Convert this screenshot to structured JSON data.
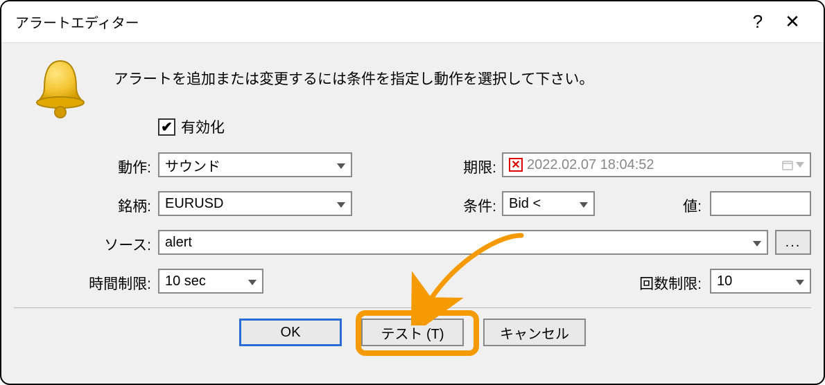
{
  "window": {
    "title": "アラートエディター"
  },
  "instruction": "アラートを追加または変更するには条件を指定し動作を選択して下さい。",
  "enable": {
    "label": "有効化",
    "checked": true
  },
  "labels": {
    "action": "動作:",
    "symbol": "銘柄:",
    "source": "ソース:",
    "timeout": "時間制限:",
    "deadline": "期限:",
    "condition": "条件:",
    "value": "値:",
    "iterations": "回数制限:"
  },
  "fields": {
    "action": "サウンド",
    "symbol": "EURUSD",
    "condition": "Bid <",
    "value": "",
    "source": "alert",
    "timeout": "10 sec",
    "iterations": "10",
    "deadline": "2022.02.07 18:04:52"
  },
  "buttons": {
    "ok": "OK",
    "test": "テスト (T)",
    "cancel": "キャンセル",
    "browse": "..."
  },
  "icons": {
    "help": "?",
    "close": "✕",
    "deadline_clear": "✕",
    "check": "✔"
  }
}
